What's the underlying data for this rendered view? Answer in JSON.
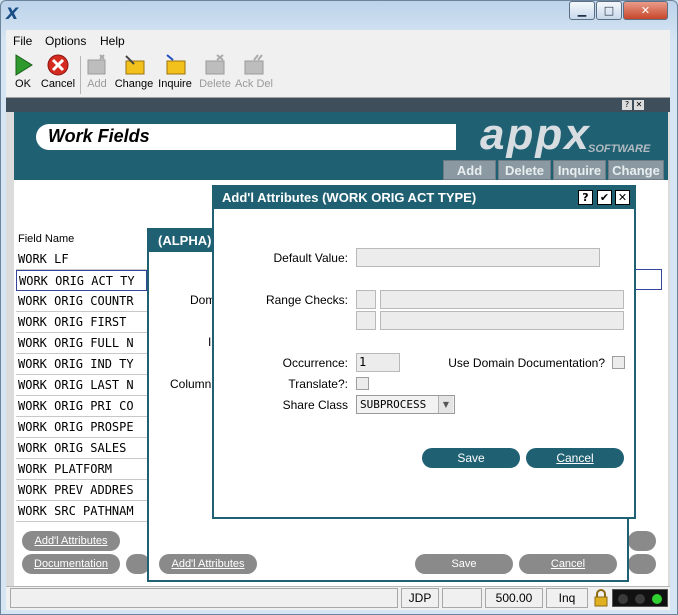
{
  "window": {
    "app_icon": "X",
    "controls": [
      "minimize-icon",
      "maximize-icon",
      "close-icon"
    ]
  },
  "menu": {
    "items": [
      "File",
      "Options",
      "Help"
    ]
  },
  "toolbar": {
    "buttons": [
      {
        "label": "OK",
        "icon": "ok-arrow-icon",
        "enabled": true
      },
      {
        "label": "Cancel",
        "icon": "cancel-x-icon",
        "enabled": true
      },
      {
        "label": "Add",
        "icon": "add-icon",
        "enabled": false
      },
      {
        "label": "Change",
        "icon": "change-icon",
        "enabled": true
      },
      {
        "label": "Inquire",
        "icon": "inquire-icon",
        "enabled": true
      },
      {
        "label": "Delete",
        "icon": "delete-icon",
        "enabled": false
      },
      {
        "label": "Ack Del",
        "icon": "ack-del-icon",
        "enabled": false
      }
    ]
  },
  "header": {
    "title": "Work Fields",
    "logo_text": "appx",
    "logo_sub": "SOFTWARE",
    "mode_buttons": [
      "Add",
      "Delete",
      "Inquire",
      "Change"
    ]
  },
  "list": {
    "column_header": "Field Name",
    "rows": [
      "WORK LF",
      "WORK ORIG ACT TY",
      "WORK ORIG COUNTR",
      "WORK ORIG FIRST",
      "WORK ORIG FULL N",
      "WORK ORIG IND TY",
      "WORK ORIG LAST N",
      "WORK ORIG PRI CO",
      "WORK ORIG PROSPE",
      "WORK ORIG SALES",
      "WORK PLATFORM",
      "WORK PREV ADDRES",
      "WORK SRC PATHNAM"
    ],
    "buttons": [
      "Add'l Attributes",
      "Documentation"
    ]
  },
  "alpha_dialog": {
    "title": "(ALPHA)",
    "labels": [
      "Dom",
      "I",
      "Column"
    ],
    "buttons": [
      "Add'l Attributes",
      "Save",
      "Cancel"
    ]
  },
  "attrs_dialog": {
    "title": "Add'l Attributes  (WORK ORIG ACT TYPE)",
    "title_buttons": [
      "?",
      "✔",
      "✕"
    ],
    "default_value_label": "Default Value:",
    "default_value": "",
    "range_checks_label": "Range Checks:",
    "occurrence_label": "Occurrence:",
    "occurrence_value": "1",
    "use_domain_doc_label": "Use Domain Documentation?",
    "translate_label": "Translate?:",
    "share_class_label": "Share Class",
    "share_class_value": "SUBPROCESS",
    "save_label": "Save",
    "cancel_label": "Cancel"
  },
  "status": {
    "user": "JDP",
    "version": "500.00",
    "mode": "Inq"
  }
}
